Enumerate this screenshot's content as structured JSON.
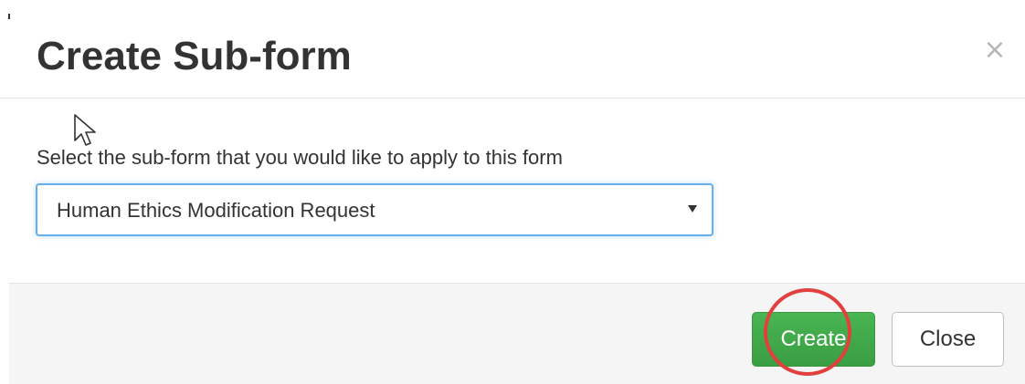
{
  "dialog": {
    "title": "Create Sub-form",
    "close_icon_glyph": "×",
    "instruction": "Select the sub-form that you would like to apply to this form",
    "subform_select": {
      "selected_value": "Human Ethics Modification Request"
    },
    "footer": {
      "create_label": "Create",
      "close_label": "Close"
    }
  },
  "colors": {
    "create_button": "#3fa548",
    "select_focus_border": "#66afe9",
    "highlight_ring": "#e2403e"
  },
  "icons": {
    "close": "close-icon",
    "dropdown": "chevron-down-icon",
    "cursor": "mouse-pointer-icon"
  }
}
